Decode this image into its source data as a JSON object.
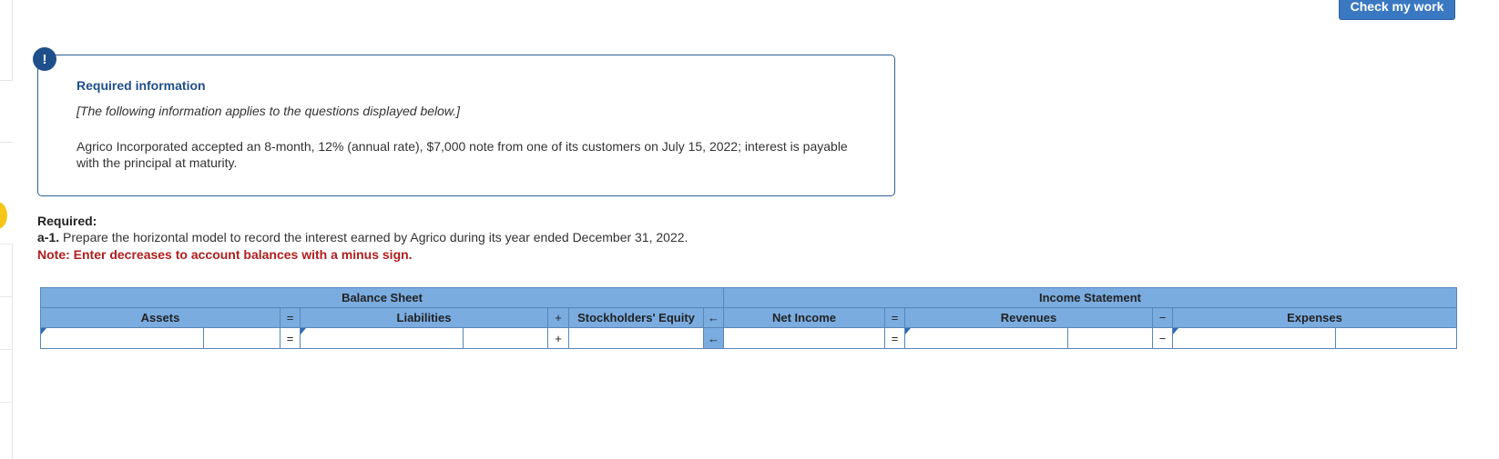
{
  "toolbar": {
    "check_label": "Check my work"
  },
  "info": {
    "alert_glyph": "!",
    "title": "Required information",
    "subtitle": "[The following information applies to the questions displayed below.]",
    "body": "Agrico Incorporated accepted an 8-month, 12% (annual rate), $7,000 note from one of its customers on July 15, 2022; interest is payable with the principal at maturity."
  },
  "required": {
    "heading": "Required:",
    "part_label": "a-1.",
    "text": "Prepare the horizontal model to record the interest earned by Agrico during its year ended December 31, 2022.",
    "note": "Note: Enter decreases to account balances with a minus sign."
  },
  "model": {
    "balance_sheet": "Balance Sheet",
    "income_statement": "Income Statement",
    "assets": "Assets",
    "liabilities": "Liabilities",
    "equity": "Stockholders' Equity",
    "net_income": "Net Income",
    "revenues": "Revenues",
    "expenses": "Expenses",
    "op_eq": "=",
    "op_plus": "+",
    "op_arrow": "←",
    "op_minus": "−",
    "values": {
      "assets_account": "",
      "assets_amount": "",
      "liabilities_account": "",
      "liabilities_amount": "",
      "equity_amount": "",
      "net_income_amount": "",
      "revenues_account": "",
      "revenues_amount": "",
      "expenses_account": "",
      "expenses_amount": ""
    }
  },
  "colors": {
    "header_blue": "#7aace0",
    "accent_blue": "#1f4f8a",
    "note_red": "#b01e1e"
  }
}
